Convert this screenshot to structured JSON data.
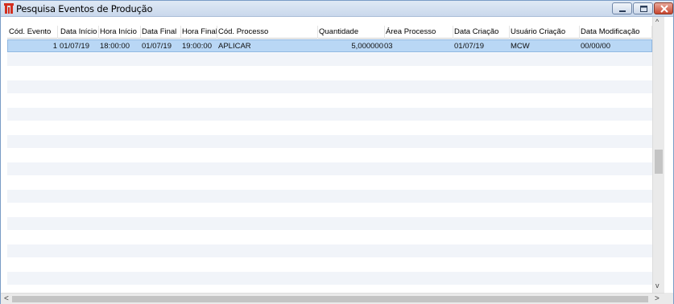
{
  "window": {
    "title": "Pesquisa Eventos de Produção",
    "controls": {
      "minimize": "minimize-icon",
      "maximize": "maximize-icon",
      "close": "close-icon"
    }
  },
  "grid": {
    "columns": [
      "Cód. Evento",
      "Data Início",
      "Hora Início",
      "Data Final",
      "Hora Final",
      "Cód. Processo",
      "Quantidade",
      "Área Processo",
      "Data Criação",
      "Usuário Criação",
      "Data Modificação"
    ],
    "rows": [
      [
        "1",
        "01/07/19",
        "18:00:00",
        "01/07/19",
        "19:00:00",
        "APLICAR",
        "5,000000",
        "03",
        "01/07/19",
        "MCW",
        "00/00/00"
      ]
    ]
  },
  "colors": {
    "selected_row": "#b9d7f5",
    "alt_row": "#f1f4f9",
    "title_bg": "#dfe9f5"
  },
  "scrollbars": {
    "up_arrow": "^",
    "down_arrow": "v",
    "left_arrow": "<",
    "right_arrow": ">"
  }
}
